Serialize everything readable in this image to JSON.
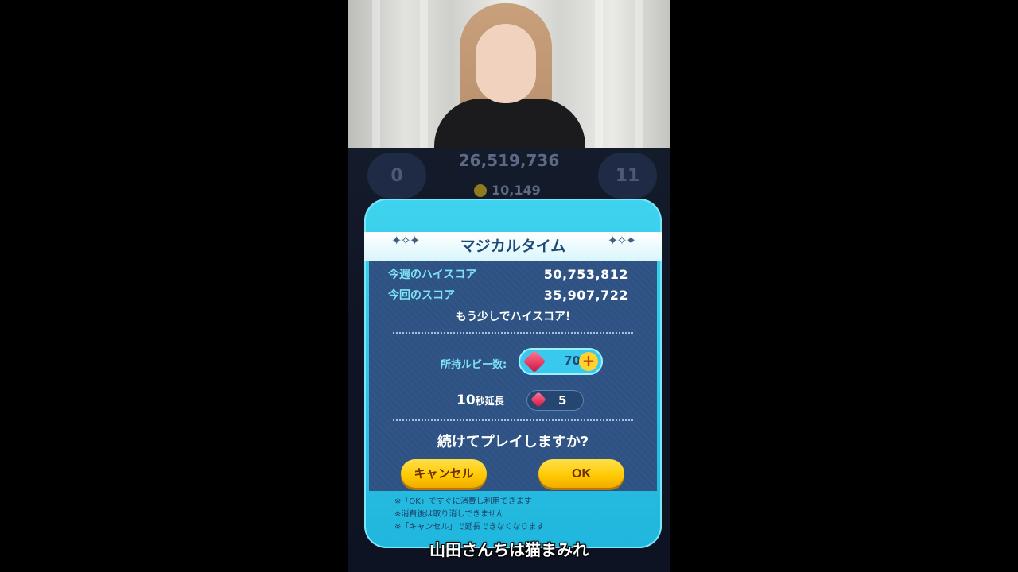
{
  "game_header": {
    "left_counter": "0",
    "right_counter": "11",
    "score": "26,519,736",
    "coins": "10,149"
  },
  "dialog": {
    "title": "マジカルタイム",
    "sparkle_glyph": "✦✧✦",
    "weekly_high_label": "今週のハイスコア",
    "weekly_high_value": "50,753,812",
    "current_label": "今回のスコア",
    "current_value": "35,907,722",
    "notice": "もう少しでハイスコア!",
    "ruby_label": "所持ルビー数:",
    "ruby_count": "70",
    "extend_big": "10",
    "extend_small": "秒延長",
    "extend_cost": "5",
    "question": "続けてプレイしますか?",
    "cancel_label": "キャンセル",
    "ok_label": "OK",
    "notes": [
      "※「OK」ですぐに消費し利用できます",
      "※消費後は取り消しできません",
      "※「キャンセル」で延長できなくなります"
    ]
  },
  "caption": "山田さんちは猫まみれ",
  "colors": {
    "dialog_frame": "#2ec5e8",
    "panel": "#2d5283",
    "label_cyan": "#7fe4f8",
    "button_yellow": "#ffc800"
  }
}
